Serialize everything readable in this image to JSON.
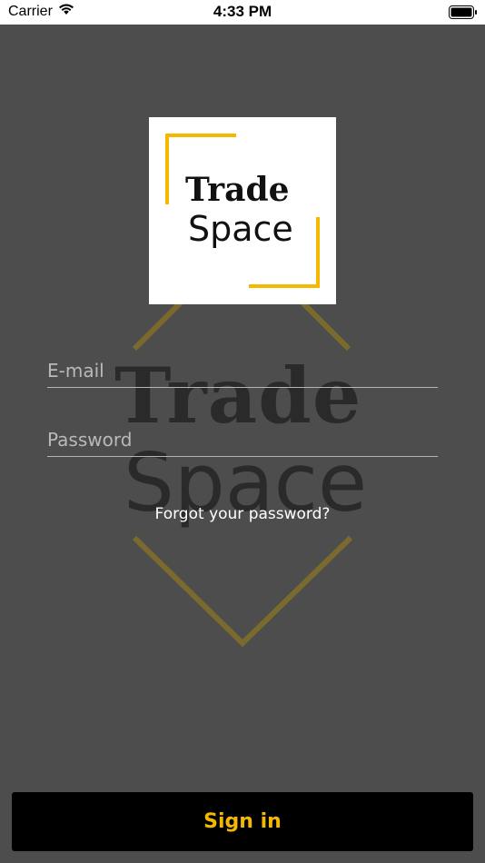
{
  "status_bar": {
    "carrier": "Carrier",
    "time": "4:33 PM",
    "icons": [
      "wifi-icon",
      "battery-icon"
    ]
  },
  "logo": {
    "line1": "Trade",
    "line2": "Space",
    "accent_color": "#f5b800"
  },
  "watermark": {
    "line1": "Trade",
    "line2": "Space"
  },
  "form": {
    "email_placeholder": "E-mail",
    "password_placeholder": "Password",
    "forgot_label": "Forgot your password?"
  },
  "actions": {
    "sign_in_label": "Sign in"
  },
  "colors": {
    "background": "#4d4d4d",
    "accent": "#f5b800",
    "button_bg": "#000000"
  }
}
